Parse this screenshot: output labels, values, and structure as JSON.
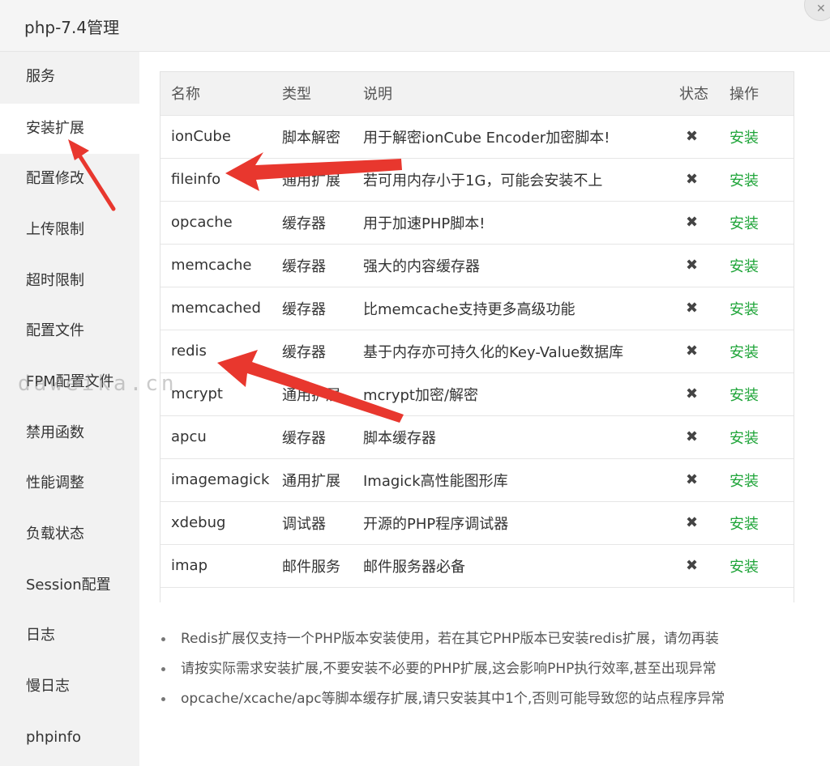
{
  "window": {
    "title": "php-7.4管理"
  },
  "sidebar": {
    "items": [
      {
        "label": "服务"
      },
      {
        "label": "安装扩展",
        "active": true
      },
      {
        "label": "配置修改"
      },
      {
        "label": "上传限制"
      },
      {
        "label": "超时限制"
      },
      {
        "label": "配置文件"
      },
      {
        "label": "FPM配置文件"
      },
      {
        "label": "禁用函数"
      },
      {
        "label": "性能调整"
      },
      {
        "label": "负载状态"
      },
      {
        "label": "Session配置"
      },
      {
        "label": "日志"
      },
      {
        "label": "慢日志"
      },
      {
        "label": "phpinfo"
      }
    ]
  },
  "table": {
    "headers": {
      "name": "名称",
      "type": "类型",
      "desc": "说明",
      "status": "状态",
      "action": "操作"
    },
    "rows": [
      {
        "name": "ionCube",
        "type": "脚本解密",
        "desc": "用于解密ionCube Encoder加密脚本!",
        "status": "✖",
        "action": "安装"
      },
      {
        "name": "fileinfo",
        "type": "通用扩展",
        "desc": "若可用内存小于1G，可能会安装不上",
        "status": "✖",
        "action": "安装"
      },
      {
        "name": "opcache",
        "type": "缓存器",
        "desc": "用于加速PHP脚本!",
        "status": "✖",
        "action": "安装"
      },
      {
        "name": "memcache",
        "type": "缓存器",
        "desc": "强大的内容缓存器",
        "status": "✖",
        "action": "安装"
      },
      {
        "name": "memcached",
        "type": "缓存器",
        "desc": "比memcache支持更多高级功能",
        "status": "✖",
        "action": "安装"
      },
      {
        "name": "redis",
        "type": "缓存器",
        "desc": "基于内存亦可持久化的Key-Value数据库",
        "status": "✖",
        "action": "安装"
      },
      {
        "name": "mcrypt",
        "type": "通用扩展",
        "desc": "mcrypt加密/解密",
        "status": "✖",
        "action": "安装"
      },
      {
        "name": "apcu",
        "type": "缓存器",
        "desc": "脚本缓存器",
        "status": "✖",
        "action": "安装"
      },
      {
        "name": "imagemagick",
        "type": "通用扩展",
        "desc": "Imagick高性能图形库",
        "status": "✖",
        "action": "安装"
      },
      {
        "name": "xdebug",
        "type": "调试器",
        "desc": "开源的PHP程序调试器",
        "status": "✖",
        "action": "安装"
      },
      {
        "name": "imap",
        "type": "邮件服务",
        "desc": "邮件服务器必备",
        "status": "✖",
        "action": "安装"
      }
    ]
  },
  "notes": [
    "Redis扩展仅支持一个PHP版本安装使用，若在其它PHP版本已安装redis扩展，请勿再装",
    "请按实际需求安装扩展,不要安装不必要的PHP扩展,这会影响PHP执行效率,甚至出现异常",
    "opcache/xcache/apc等脚本缓存扩展,请只安装其中1个,否则可能导致您的站点程序异常"
  ],
  "watermark": "daweika.cn",
  "colors": {
    "install": "#20a53a",
    "annotation_arrow": "#e8372e",
    "sidebar_bg": "#f2f2f2"
  }
}
